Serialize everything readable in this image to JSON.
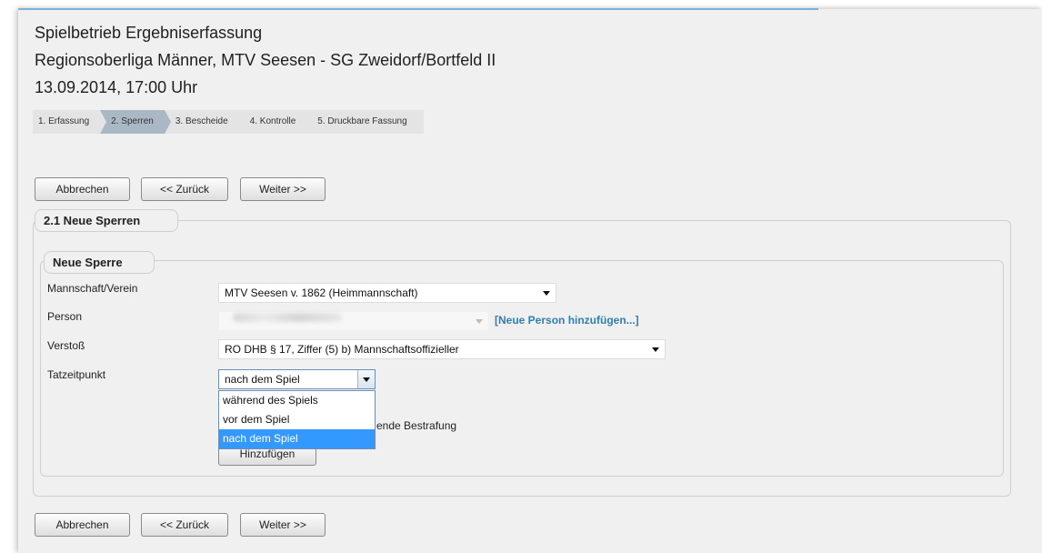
{
  "header": {
    "title": "Spielbetrieb Ergebniserfassung",
    "match": "Regionsoberliga Männer, MTV Seesen - SG Zweidorf/Bortfeld II",
    "datetime": "13.09.2014, 17:00 Uhr"
  },
  "steps": [
    {
      "label": "1. Erfassung",
      "active": false
    },
    {
      "label": "2. Sperren",
      "active": true
    },
    {
      "label": "3. Bescheide",
      "active": false
    },
    {
      "label": "4. Kontrolle",
      "active": false
    },
    {
      "label": "5. Druckbare Fassung",
      "active": false
    }
  ],
  "nav": {
    "cancel": "Abbrechen",
    "back": "<< Zurück",
    "next": "Weiter >>"
  },
  "section": {
    "title": "2.1 Neue Sperren",
    "sub_title": "Neue Sperre"
  },
  "form": {
    "team_label": "Mannschaft/Verein",
    "team_value": "MTV Seesen v. 1862 (Heimmannschaft)",
    "person_label": "Person",
    "person_link": "[Neue Person hinzufügen...]",
    "violation_label": "Verstoß",
    "violation_value": "RO DHB § 17, Ziffer (5) b) Mannschaftsoffizieller",
    "time_label": "Tatzeitpunkt",
    "time_value": "nach dem Spiel",
    "time_options": [
      "während des Spiels",
      "vor dem Spiel",
      "nach dem Spiel"
    ],
    "hidden_text_partial": "ende Bestrafung",
    "add_button": "Hinzufügen"
  },
  "colors": {
    "link": "#2f7fb0",
    "active_step": "#a9b8c4",
    "selected_option": "#3399ff"
  }
}
